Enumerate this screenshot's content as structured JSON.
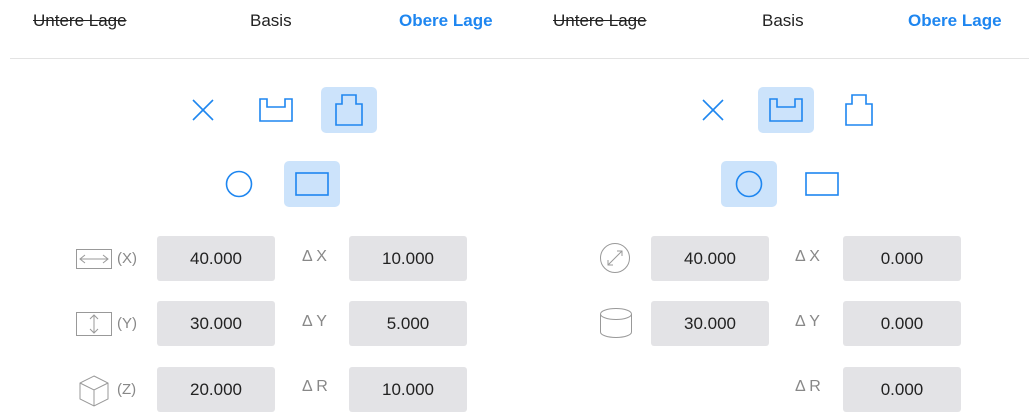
{
  "left": {
    "tabs": [
      "Untere Lage",
      "Basis",
      "Obere Lage"
    ],
    "fields": {
      "x_value": "40.000",
      "dx_label": "Δ X",
      "dx_value": "10.000",
      "y_value": "30.000",
      "dy_label": "Δ Y",
      "dy_value": "5.000",
      "z_value": "20.000",
      "dr_label": "Δ R",
      "dr_value": "10.000"
    },
    "axis_labels": {
      "x": "(X)",
      "y": "(Y)",
      "z": "(Z)"
    },
    "selected_profile": "raised-profile",
    "selected_shape": "rectangle"
  },
  "right": {
    "tabs": [
      "Untere Lage",
      "Basis",
      "Obere Lage"
    ],
    "fields": {
      "diameter_value": "40.000",
      "dx_label": "Δ X",
      "dx_value": "0.000",
      "height_value": "30.000",
      "dy_label": "Δ Y",
      "dy_value": "0.000",
      "dr_label": "Δ R",
      "dr_value": "0.000"
    },
    "selected_profile": "recessed-profile",
    "selected_shape": "circle"
  },
  "colors": {
    "accent": "#1e86f0",
    "selected_bg": "#cce3fb",
    "field_bg": "#e3e3e6"
  }
}
